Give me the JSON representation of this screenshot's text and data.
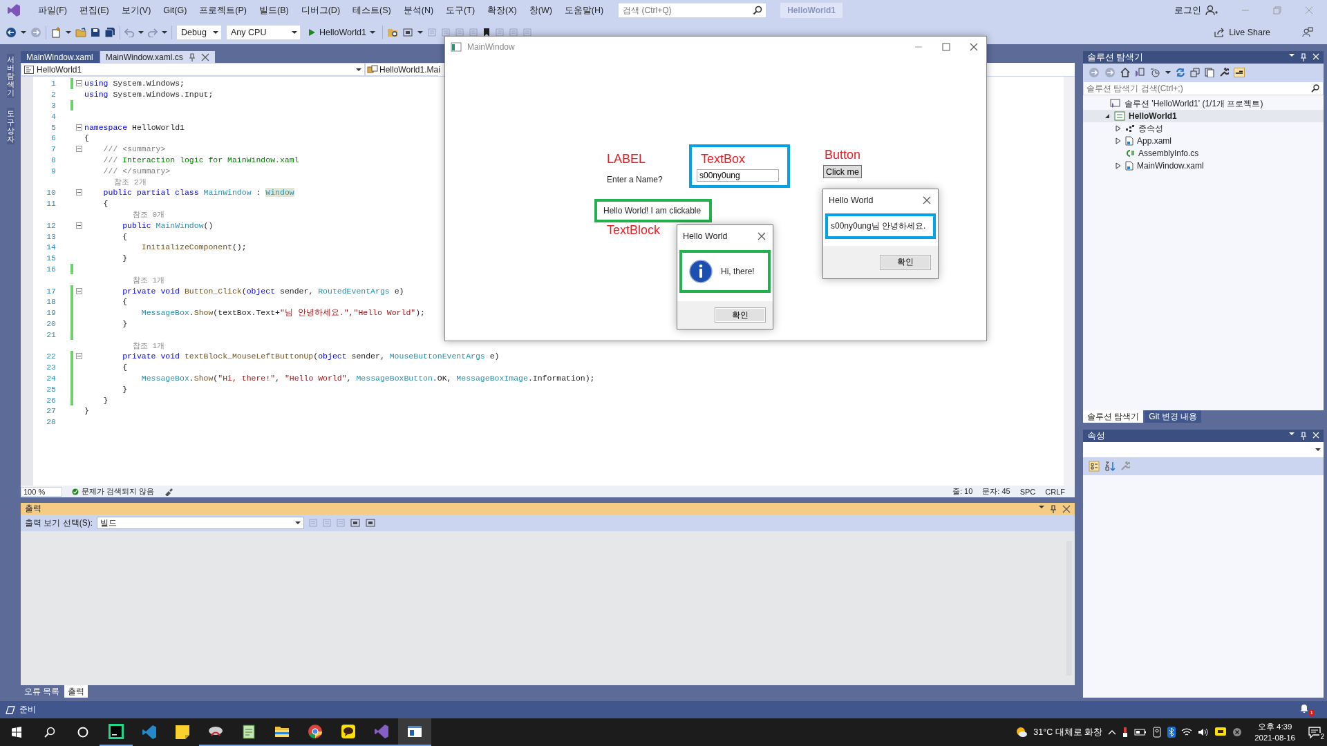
{
  "menu_bar": {
    "items": [
      "파일(F)",
      "편집(E)",
      "보기(V)",
      "Git(G)",
      "프로젝트(P)",
      "빌드(B)",
      "디버그(D)",
      "테스트(S)",
      "분석(N)",
      "도구(T)",
      "확장(X)",
      "창(W)",
      "도움말(H)"
    ],
    "search": {
      "placeholder": "검색 (Ctrl+Q)"
    },
    "solution_name": "HelloWorld1",
    "login": "로그인"
  },
  "toolbar": {
    "configuration": "Debug",
    "platform": "Any CPU",
    "start": "HelloWorld1",
    "live_share": "Live Share"
  },
  "side_strip": [
    "서버 탐색기",
    "도구 상자"
  ],
  "editor": {
    "tabs": [
      {
        "label": "MainWindow.xaml",
        "selected": false
      },
      {
        "label": "MainWindow.xaml.cs",
        "selected": true
      }
    ],
    "nav": [
      "HelloWorld1",
      "HelloWorld1.Mai"
    ],
    "lines": [
      {
        "kind": "code",
        "number": "1",
        "changed": true,
        "foldable": true,
        "tokens": [
          {
            "kind": "keyword",
            "text": "using"
          },
          {
            "kind": "plain",
            "text": " System.Windows;"
          }
        ]
      },
      {
        "kind": "code",
        "number": "2",
        "changed": false,
        "foldable": false,
        "tokens": [
          {
            "kind": "keyword",
            "text": "using"
          },
          {
            "kind": "plain",
            "text": " System.Windows.Input;"
          }
        ]
      },
      {
        "kind": "code",
        "number": "3",
        "changed": true,
        "foldable": false
      },
      {
        "kind": "code",
        "number": "4",
        "changed": false,
        "foldable": false
      },
      {
        "kind": "code",
        "number": "5",
        "changed": false,
        "foldable": true,
        "tokens": [
          {
            "kind": "keyword",
            "text": "namespace"
          },
          {
            "kind": "plain",
            "text": " HelloWorld1"
          }
        ]
      },
      {
        "kind": "code",
        "number": "6",
        "changed": false,
        "foldable": false,
        "tokens": [
          {
            "kind": "plain",
            "text": "{"
          }
        ]
      },
      {
        "kind": "code",
        "number": "7",
        "changed": false,
        "foldable": true,
        "tokens": [
          {
            "kind": "doc",
            "text": "    /// <summary>"
          }
        ]
      },
      {
        "kind": "code",
        "number": "8",
        "changed": false,
        "foldable": false,
        "tokens": [
          {
            "kind": "doc",
            "text": "    ///"
          },
          {
            "kind": "comment",
            "text": " Interaction logic for MainWindow.xaml"
          }
        ]
      },
      {
        "kind": "code",
        "number": "9",
        "changed": false,
        "foldable": false,
        "tokens": [
          {
            "kind": "doc",
            "text": "    /// </summary>"
          }
        ]
      },
      {
        "kind": "lens",
        "text": "    참조 2개"
      },
      {
        "kind": "code",
        "number": "10",
        "changed": false,
        "foldable": true,
        "tokens": [
          {
            "kind": "keyword",
            "text": "    public partial class"
          },
          {
            "kind": "type",
            "text": " MainWindow"
          },
          {
            "kind": "plain",
            "text": " : "
          },
          {
            "kind": "highlight",
            "text": "Window"
          }
        ]
      },
      {
        "kind": "code",
        "number": "11",
        "changed": false,
        "foldable": false,
        "tokens": [
          {
            "kind": "plain",
            "text": "    {"
          }
        ]
      },
      {
        "kind": "lens",
        "text": "        참조 0개"
      },
      {
        "kind": "code",
        "number": "12",
        "changed": false,
        "foldable": true,
        "tokens": [
          {
            "kind": "keyword",
            "text": "        public"
          },
          {
            "kind": "type",
            "text": " MainWindow"
          },
          {
            "kind": "plain",
            "text": "()"
          }
        ]
      },
      {
        "kind": "code",
        "number": "13",
        "changed": false,
        "foldable": false,
        "tokens": [
          {
            "kind": "plain",
            "text": "        {"
          }
        ]
      },
      {
        "kind": "code",
        "number": "14",
        "changed": false,
        "foldable": false,
        "tokens": [
          {
            "kind": "method",
            "text": "            InitializeComponent"
          },
          {
            "kind": "plain",
            "text": "();"
          }
        ]
      },
      {
        "kind": "code",
        "number": "15",
        "changed": false,
        "foldable": false,
        "tokens": [
          {
            "kind": "plain",
            "text": "        }"
          }
        ]
      },
      {
        "kind": "code",
        "number": "16",
        "changed": true,
        "foldable": false
      },
      {
        "kind": "lens",
        "text": "        참조 1개"
      },
      {
        "kind": "code",
        "number": "17",
        "changed": true,
        "foldable": true,
        "tokens": [
          {
            "kind": "keyword",
            "text": "        private void"
          },
          {
            "kind": "method",
            "text": " Button_Click"
          },
          {
            "kind": "plain",
            "text": "("
          },
          {
            "kind": "keyword",
            "text": "object"
          },
          {
            "kind": "plain",
            "text": " sender, "
          },
          {
            "kind": "type",
            "text": "RoutedEventArgs"
          },
          {
            "kind": "plain",
            "text": " e)"
          }
        ]
      },
      {
        "kind": "code",
        "number": "18",
        "changed": true,
        "foldable": false,
        "tokens": [
          {
            "kind": "plain",
            "text": "        {"
          }
        ]
      },
      {
        "kind": "code",
        "number": "19",
        "changed": true,
        "foldable": false,
        "tokens": [
          {
            "kind": "type",
            "text": "            MessageBox"
          },
          {
            "kind": "plain",
            "text": "."
          },
          {
            "kind": "method",
            "text": "Show"
          },
          {
            "kind": "plain",
            "text": "(textBox.Text+"
          },
          {
            "kind": "string",
            "text": "\"님 안녕하세요.\""
          },
          {
            "kind": "plain",
            "text": ","
          },
          {
            "kind": "string",
            "text": "\"Hello World\""
          },
          {
            "kind": "plain",
            "text": ");"
          }
        ]
      },
      {
        "kind": "code",
        "number": "20",
        "changed": true,
        "foldable": false,
        "tokens": [
          {
            "kind": "plain",
            "text": "        }"
          }
        ]
      },
      {
        "kind": "code",
        "number": "21",
        "changed": true,
        "foldable": false
      },
      {
        "kind": "lens",
        "text": "        참조 1개"
      },
      {
        "kind": "code",
        "number": "22",
        "changed": true,
        "foldable": true,
        "tokens": [
          {
            "kind": "keyword",
            "text": "        private void"
          },
          {
            "kind": "method",
            "text": " textBlock_MouseLeftButtonUp"
          },
          {
            "kind": "plain",
            "text": "("
          },
          {
            "kind": "keyword",
            "text": "object"
          },
          {
            "kind": "plain",
            "text": " sender, "
          },
          {
            "kind": "type",
            "text": "MouseButtonEventArgs"
          },
          {
            "kind": "plain",
            "text": " e)"
          }
        ]
      },
      {
        "kind": "code",
        "number": "23",
        "changed": true,
        "foldable": false,
        "tokens": [
          {
            "kind": "plain",
            "text": "        {"
          }
        ]
      },
      {
        "kind": "code",
        "number": "24",
        "changed": true,
        "foldable": false,
        "tokens": [
          {
            "kind": "type",
            "text": "            MessageBox"
          },
          {
            "kind": "plain",
            "text": "."
          },
          {
            "kind": "method",
            "text": "Show"
          },
          {
            "kind": "plain",
            "text": "("
          },
          {
            "kind": "string",
            "text": "\"Hi, there!\""
          },
          {
            "kind": "plain",
            "text": ", "
          },
          {
            "kind": "string",
            "text": "\"Hello World\""
          },
          {
            "kind": "plain",
            "text": ", "
          },
          {
            "kind": "type",
            "text": "MessageBoxButton"
          },
          {
            "kind": "plain",
            "text": ".OK, "
          },
          {
            "kind": "type",
            "text": "MessageBoxImage"
          },
          {
            "kind": "plain",
            "text": ".Information);"
          }
        ]
      },
      {
        "kind": "code",
        "number": "25",
        "changed": true,
        "foldable": false,
        "tokens": [
          {
            "kind": "plain",
            "text": "        }"
          }
        ]
      },
      {
        "kind": "code",
        "number": "26",
        "changed": true,
        "foldable": false,
        "tokens": [
          {
            "kind": "plain",
            "text": "    }"
          }
        ]
      },
      {
        "kind": "code",
        "number": "27",
        "changed": false,
        "foldable": false,
        "tokens": [
          {
            "kind": "plain",
            "text": "}"
          }
        ]
      },
      {
        "kind": "code",
        "number": "28",
        "changed": false,
        "foldable": false
      }
    ],
    "status": {
      "zoom": "100 %",
      "issues": "문제가 검색되지 않음",
      "line": "줄: 10",
      "column": "문자: 45",
      "whitespace": "SPC",
      "line_ending": "CRLF"
    }
  },
  "output": {
    "title": "출력",
    "source_label": "출력 보기 선택(S):",
    "source": "빌드",
    "tabs": [
      {
        "label": "오류 목록",
        "selected": false
      },
      {
        "label": "출력",
        "selected": true
      }
    ]
  },
  "solution_explorer": {
    "title": "솔루션 탐색기",
    "search": {
      "placeholder": "솔루션 탐색기 검색(Ctrl+;)"
    },
    "tree": [
      {
        "label": "솔루션 'HelloWorld1' (1/1개 프로젝트)",
        "kind": "solution",
        "selected": false,
        "children": [
          {
            "label": "HelloWorld1",
            "kind": "project",
            "selected": true,
            "expanded": true,
            "children": [
              {
                "label": "종속성",
                "kind": "dependencies",
                "selected": false,
                "expanded": false
              },
              {
                "label": "App.xaml",
                "kind": "xaml",
                "selected": false,
                "expanded": false
              },
              {
                "label": "AssemblyInfo.cs",
                "kind": "csharp",
                "selected": false
              },
              {
                "label": "MainWindow.xaml",
                "kind": "xaml",
                "selected": false,
                "expanded": false
              }
            ]
          }
        ]
      }
    ],
    "tabs": [
      {
        "label": "솔루션 탐색기",
        "selected": true
      },
      {
        "label": "Git 변경 내용",
        "selected": false
      }
    ]
  },
  "properties": {
    "title": "속성"
  },
  "status_bar": {
    "text": "준비",
    "notifications": "1"
  },
  "app_window": {
    "title": "MainWindow",
    "label": "Enter a Name?",
    "textbox_value": "s00ny0ung",
    "button": "Click me",
    "textblock": "Hello World! I am clickable",
    "annotations": [
      {
        "kind": "label",
        "text": "LABEL"
      },
      {
        "kind": "textbox",
        "text": "TextBox"
      },
      {
        "kind": "button",
        "text": "Button"
      },
      {
        "kind": "textblock",
        "text": "TextBlock"
      }
    ],
    "dialogs": [
      {
        "kind": "information",
        "title": "Hello World",
        "message": "Hi, there!",
        "button": "확인"
      },
      {
        "kind": "plain",
        "title": "Hello World",
        "message": "s00ny0ung님 안녕하세요.",
        "button": "확인"
      }
    ]
  },
  "taskbar": {
    "weather": "31°C 대체로 화창",
    "time": "오후 4:39",
    "date": "2021-08-16",
    "notifications": "2"
  }
}
